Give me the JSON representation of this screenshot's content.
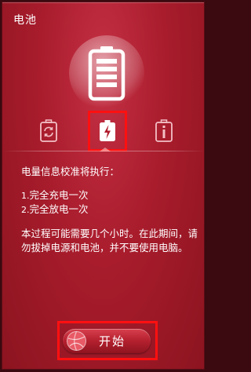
{
  "window": {
    "title": "电池"
  },
  "icons": {
    "hero": "battery-icon",
    "tab_1": "battery-refresh-icon",
    "tab_2": "battery-charge-icon",
    "tab_3": "battery-info-icon",
    "start": "ball-icon"
  },
  "tabs": {
    "selected_index": 1
  },
  "calibration": {
    "heading": "电量信息校准将执行：",
    "steps": [
      {
        "num": "1.",
        "text": "完全充电一次"
      },
      {
        "num": "2.",
        "text": "完全放电一次"
      }
    ],
    "description": "本过程可能需要几个小时。在此期间，请勿拔掉电源和电池，并不要使用电脑。"
  },
  "start_button": {
    "label": "开始"
  },
  "colors": {
    "panel": "#a81c2c",
    "highlight_box": "#ff1010",
    "text": "#ffffff"
  }
}
